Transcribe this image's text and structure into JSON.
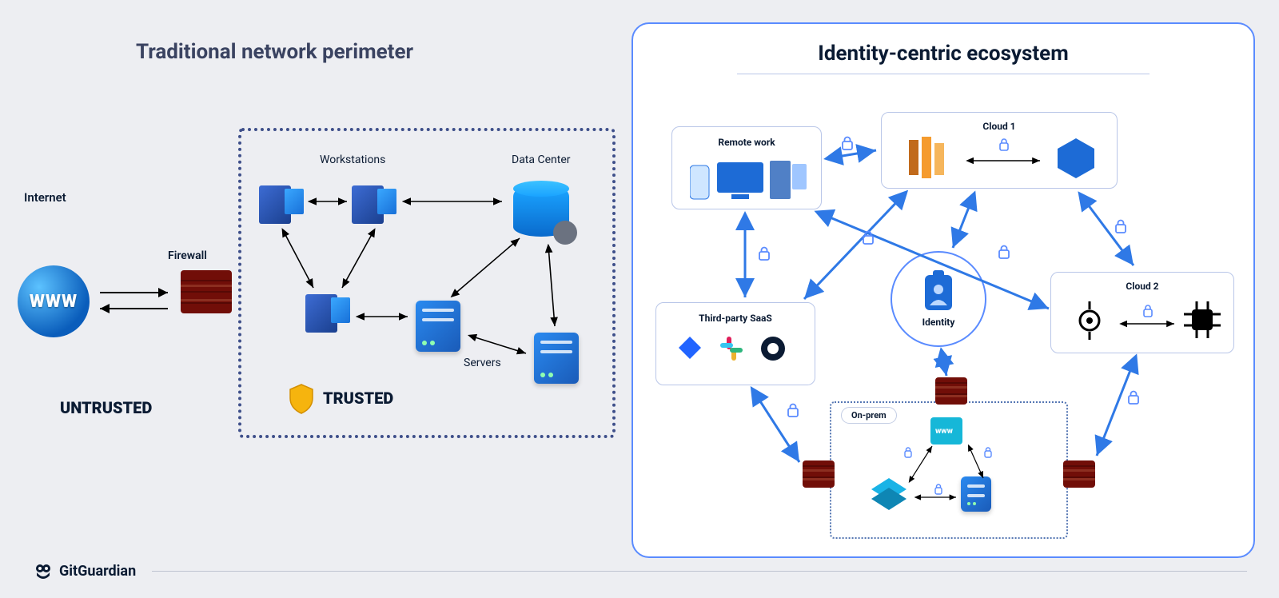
{
  "brand": "GitGuardian",
  "left": {
    "title": "Traditional network perimeter",
    "internet_label": "Internet",
    "globe_text": "WWW",
    "firewall_label": "Firewall",
    "untrusted": "UNTRUSTED",
    "workstations_label": "Workstations",
    "datacenter_label": "Data Center",
    "servers_label": "Servers",
    "trusted": "TRUSTED"
  },
  "right": {
    "title": "Identity-centric ecosystem",
    "remote_work": "Remote work",
    "cloud1": "Cloud 1",
    "cloud2": "Cloud 2",
    "third_party": "Third-party SaaS",
    "identity": "Identity",
    "onprem": "On-prem",
    "onprem_www": "www"
  }
}
